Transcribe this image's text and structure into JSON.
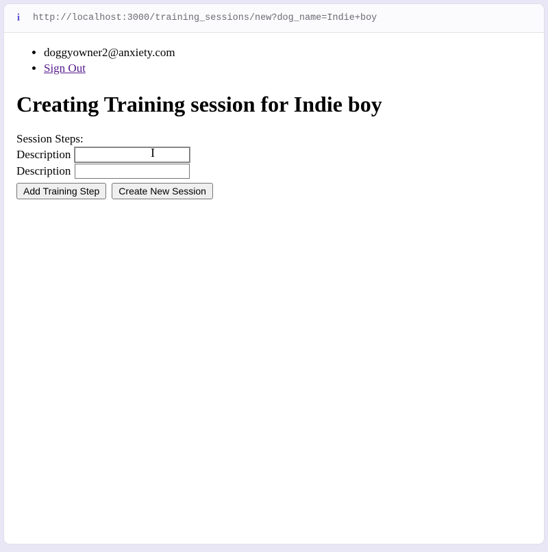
{
  "address_bar": {
    "info_icon": "i",
    "url": "http://localhost:3000/training_sessions/new?dog_name=Indie+boy"
  },
  "header": {
    "email": "doggyowner2@anxiety.com",
    "signout_label": "Sign Out"
  },
  "page_title": "Creating Training session for Indie boy",
  "form": {
    "session_steps_label": "Session Steps:",
    "steps": [
      {
        "label": "Description",
        "value": ""
      },
      {
        "label": "Description",
        "value": ""
      }
    ],
    "add_step_button": "Add Training Step",
    "create_session_button": "Create New Session"
  }
}
